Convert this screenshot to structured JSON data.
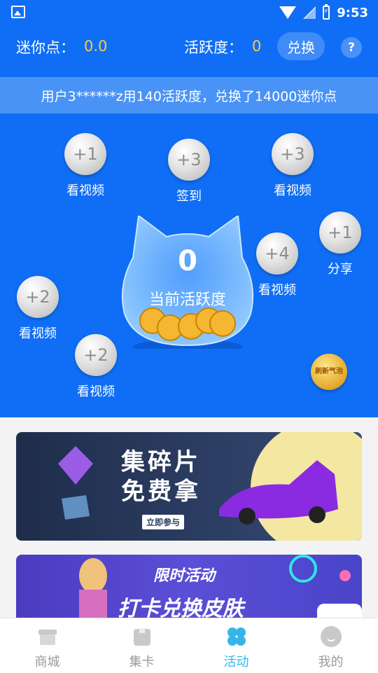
{
  "status_bar": {
    "time": "9:53",
    "icons": [
      "image-icon",
      "wifi-icon",
      "no-signal-icon",
      "battery-charging-icon"
    ]
  },
  "header": {
    "mini_points_label": "迷你点：",
    "mini_points_value": "0.0",
    "activity_label": "活跃度：",
    "activity_value": "0",
    "exchange_button": "兑换",
    "help_button": "?"
  },
  "ticker": {
    "text": "用户3******z用140活跃度，兑换了14000迷你点"
  },
  "bubbles": [
    {
      "value": "+1",
      "label": "看视频"
    },
    {
      "value": "+3",
      "label": "签到"
    },
    {
      "value": "+3",
      "label": "看视频"
    },
    {
      "value": "+1",
      "label": "分享"
    },
    {
      "value": "+4",
      "label": "看视频"
    },
    {
      "value": "+2",
      "label": "看视频"
    },
    {
      "value": "+2",
      "label": "看视频"
    }
  ],
  "mascot": {
    "value": "0",
    "label": "当前活跃度"
  },
  "refresh_button": "刷新气泡",
  "banners": [
    {
      "title_line1": "集碎片",
      "title_line2": "免费拿",
      "button": "立即参与"
    },
    {
      "title": "限时活动",
      "subtitle": "打卡兑换皮肤"
    }
  ],
  "bottom_nav": [
    {
      "label": "商城",
      "icon": "store-icon",
      "active": false
    },
    {
      "label": "集卡",
      "icon": "card-bag-icon",
      "active": false
    },
    {
      "label": "活动",
      "icon": "activity-icon",
      "active": true
    },
    {
      "label": "我的",
      "icon": "profile-icon",
      "active": false
    }
  ],
  "colors": {
    "primary_blue": "#0f6ef5",
    "accent_gold": "#ffc84a",
    "active_nav": "#36b5e8"
  }
}
